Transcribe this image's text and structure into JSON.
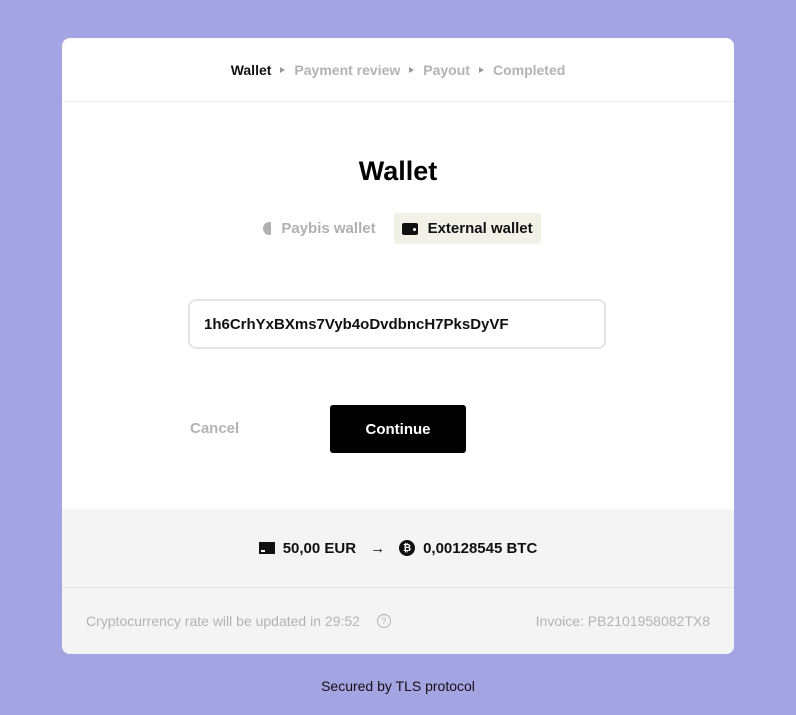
{
  "steps": [
    "Wallet",
    "Payment review",
    "Payout",
    "Completed"
  ],
  "title": "Wallet",
  "tabs": {
    "paybis": "Paybis wallet",
    "external": "External wallet",
    "selected": "External wallet"
  },
  "address": {
    "value": "1h6CrhYxBXms7Vyb4oDvdbncH7PksDyVF"
  },
  "buttons": {
    "cancel": "Cancel",
    "continue": "Continue"
  },
  "amount": {
    "from": "50,00 EUR",
    "arrow": "→",
    "to": "0,00128545 BTC",
    "btc_symbol": "₿"
  },
  "footer": {
    "rate_text": "Cryptocurrency rate will be updated in 29:52",
    "help": "?",
    "invoice": "Invoice: PB2101958082TX8"
  },
  "secured": "Secured by TLS protocol",
  "colors": {
    "background": "#a4a4e3",
    "accent": "#000000"
  }
}
